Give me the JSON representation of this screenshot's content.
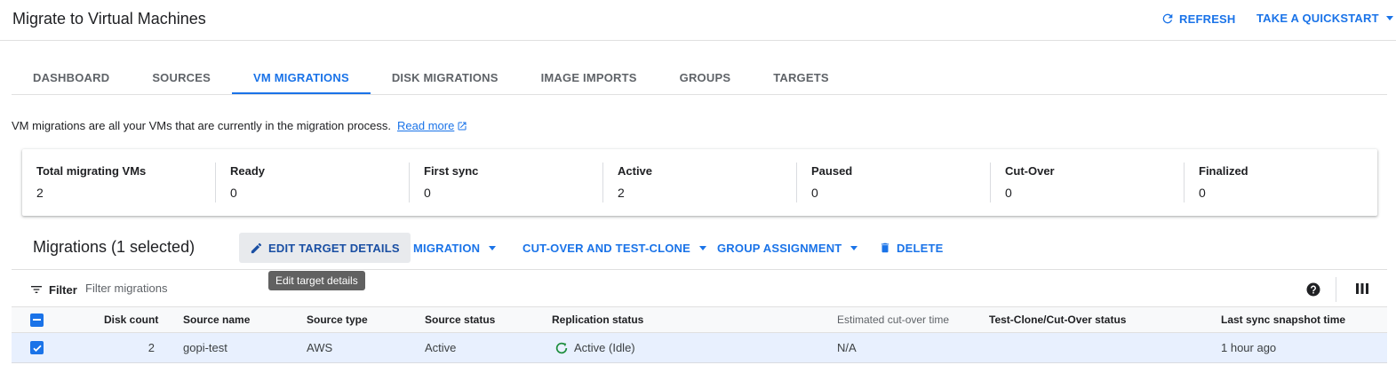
{
  "header": {
    "title": "Migrate to Virtual Machines",
    "refresh_label": "REFRESH",
    "quickstart_label": "TAKE A QUICKSTART"
  },
  "tabs": [
    {
      "label": "DASHBOARD",
      "active": false
    },
    {
      "label": "SOURCES",
      "active": false
    },
    {
      "label": "VM MIGRATIONS",
      "active": true
    },
    {
      "label": "DISK MIGRATIONS",
      "active": false
    },
    {
      "label": "IMAGE IMPORTS",
      "active": false
    },
    {
      "label": "GROUPS",
      "active": false
    },
    {
      "label": "TARGETS",
      "active": false
    }
  ],
  "intro": {
    "text": "VM migrations are all your VMs that are currently in the migration process.",
    "read_more": "Read more"
  },
  "stats": [
    {
      "label": "Total migrating VMs",
      "value": "2"
    },
    {
      "label": "Ready",
      "value": "0"
    },
    {
      "label": "First sync",
      "value": "0"
    },
    {
      "label": "Active",
      "value": "2"
    },
    {
      "label": "Paused",
      "value": "0"
    },
    {
      "label": "Cut-Over",
      "value": "0"
    },
    {
      "label": "Finalized",
      "value": "0"
    }
  ],
  "toolbar": {
    "title": "Migrations (1 selected)",
    "edit_label": "EDIT TARGET DETAILS",
    "migration_label": "MIGRATION",
    "cutover_label": "CUT-OVER AND TEST-CLONE",
    "group_label": "GROUP ASSIGNMENT",
    "delete_label": "DELETE",
    "tooltip": "Edit target details"
  },
  "filter": {
    "label": "Filter",
    "placeholder": "Filter migrations"
  },
  "table": {
    "columns": {
      "disk_count": "Disk count",
      "source_name": "Source name",
      "source_type": "Source type",
      "source_status": "Source status",
      "replication_status": "Replication status",
      "estimated_cutover": "Estimated cut-over time",
      "test_clone_status": "Test-Clone/Cut-Over status",
      "last_sync": "Last sync snapshot time"
    },
    "rows": [
      {
        "selected": true,
        "disk_count": "2",
        "source_name": "gopi-test",
        "source_type": "AWS",
        "source_status": "Active",
        "replication_status": "Active (Idle)",
        "estimated_cutover": "N/A",
        "test_clone_status": "",
        "last_sync": "1 hour ago"
      }
    ]
  },
  "colors": {
    "accent": "#1a73e8",
    "success": "#1e8e3e",
    "selected_row": "#e8f0fe"
  },
  "icons": [
    "refresh-icon",
    "chevron-down-icon",
    "external-link-icon",
    "pencil-icon",
    "trash-icon",
    "filter-icon",
    "help-icon",
    "columns-icon",
    "checkbox-icon",
    "status-success-icon"
  ]
}
